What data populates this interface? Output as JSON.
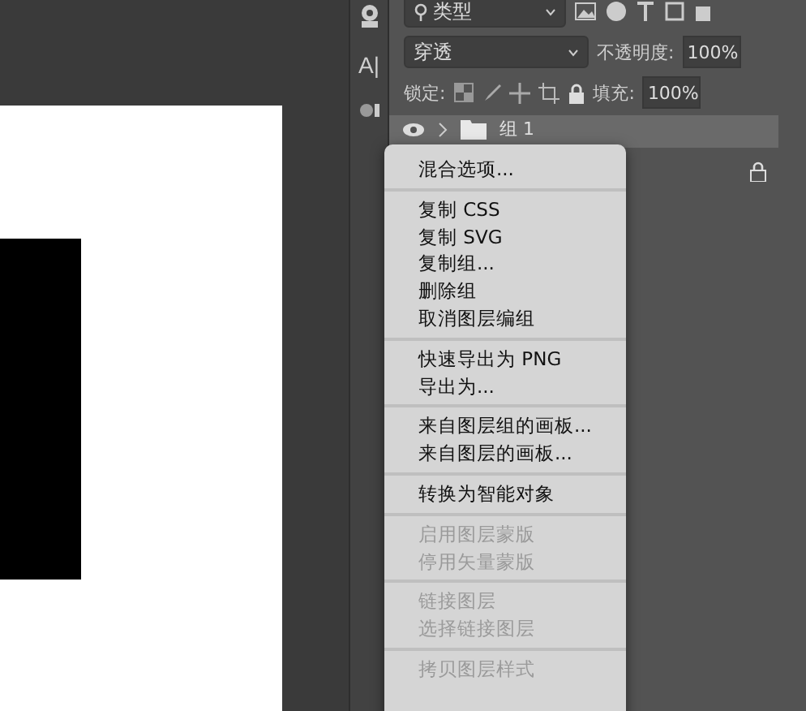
{
  "type_tool": {
    "label": "A|"
  },
  "filter": {
    "value": "类型"
  },
  "blend": {
    "value": "穿透"
  },
  "opacity": {
    "label": "不透明度:",
    "value": "100%"
  },
  "lock": {
    "label": "锁定:"
  },
  "fill": {
    "label": "填充:",
    "value": "100%"
  },
  "layers": [
    {
      "name": "组 1",
      "selected": true,
      "visible": true
    }
  ],
  "menu": {
    "sections": [
      [
        {
          "label": "混合选项...",
          "disabled": false
        }
      ],
      [
        {
          "label": "复制 CSS",
          "disabled": false
        },
        {
          "label": "复制 SVG",
          "disabled": false
        },
        {
          "label": "复制组...",
          "disabled": false
        },
        {
          "label": "删除组",
          "disabled": false
        },
        {
          "label": "取消图层编组",
          "disabled": false
        }
      ],
      [
        {
          "label": "快速导出为 PNG",
          "disabled": false
        },
        {
          "label": "导出为...",
          "disabled": false
        }
      ],
      [
        {
          "label": "来自图层组的画板...",
          "disabled": false
        },
        {
          "label": "来自图层的画板...",
          "disabled": false
        }
      ],
      [
        {
          "label": "转换为智能对象",
          "disabled": false
        }
      ],
      [
        {
          "label": "启用图层蒙版",
          "disabled": true
        },
        {
          "label": "停用矢量蒙版",
          "disabled": true
        }
      ],
      [
        {
          "label": "链接图层",
          "disabled": true
        },
        {
          "label": "选择链接图层",
          "disabled": true
        }
      ],
      [
        {
          "label": "拷贝图层样式",
          "disabled": true
        }
      ]
    ]
  }
}
